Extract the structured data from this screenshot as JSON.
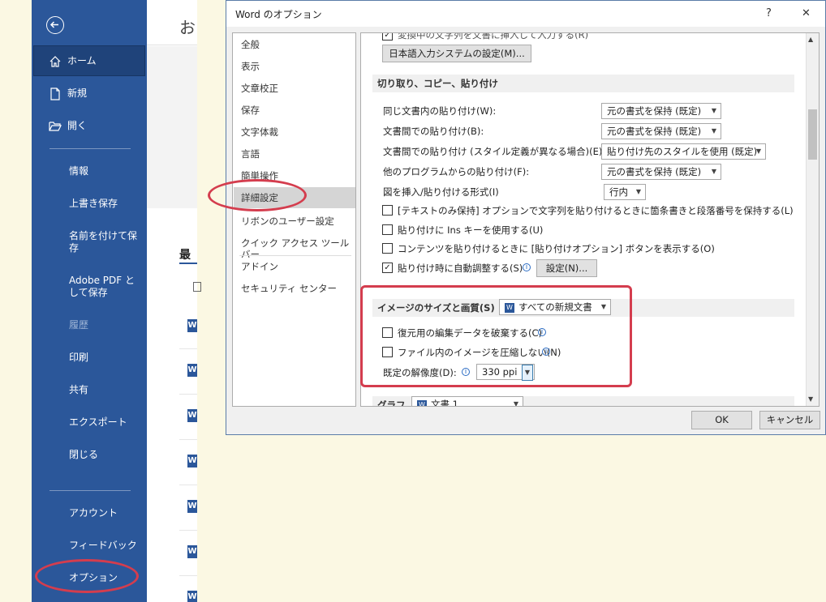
{
  "backstage": {
    "title_partial": "お",
    "recent_partial": "最",
    "items": {
      "home": "ホーム",
      "new": "新規",
      "open": "開く",
      "info": "情報",
      "save": "上書き保存",
      "saveas": "名前を付けて保存",
      "adobe": "Adobe PDF として保存",
      "history": "履歴",
      "print": "印刷",
      "share": "共有",
      "export": "エクスポート",
      "close": "閉じる",
      "account": "アカウント",
      "feedback": "フィードバック",
      "options": "オプション"
    },
    "doc_icon_letter": "W"
  },
  "dialog": {
    "title": "Word のオプション",
    "help": "?",
    "close": "✕",
    "nav": [
      "全般",
      "表示",
      "文章校正",
      "保存",
      "文字体裁",
      "言語",
      "簡単操作",
      "詳細設定",
      "リボンのユーザー設定",
      "クイック アクセス ツール バー",
      "アドイン",
      "セキュリティ センター"
    ],
    "nav_selected_index": 7,
    "ime_row_partial": "変換中の文字列を文書に挿入して入力する(R)",
    "ime_button": "日本語入力システムの設定(M)...",
    "cutpaste": {
      "header": "切り取り、コピー、貼り付け",
      "rows": [
        {
          "label": "同じ文書内の貼り付け(W):",
          "value": "元の書式を保持 (既定)"
        },
        {
          "label": "文書間での貼り付け(B):",
          "value": "元の書式を保持 (既定)"
        },
        {
          "label": "文書間での貼り付け (スタイル定義が異なる場合)(E):",
          "value": "貼り付け先のスタイルを使用 (既定)"
        },
        {
          "label": "他のプログラムからの貼り付け(F):",
          "value": "元の書式を保持 (既定)"
        },
        {
          "label": "図を挿入/貼り付ける形式(I)",
          "value": "行内"
        }
      ],
      "checks": [
        {
          "label": "[テキストのみ保持] オプションで文字列を貼り付けるときに箇条書きと段落番号を保持する(L)",
          "checked": false
        },
        {
          "label": "貼り付けに Ins キーを使用する(U)",
          "checked": false
        },
        {
          "label": "コンテンツを貼り付けるときに [貼り付けオプション] ボタンを表示する(O)",
          "checked": false
        },
        {
          "label": "貼り付け時に自動調整する(S)",
          "checked": true
        }
      ],
      "settings_button": "設定(N)..."
    },
    "image": {
      "header": "イメージのサイズと画質(S)",
      "doc_dropdown": "すべての新規文書",
      "checks": [
        {
          "label": "復元用の編集データを破棄する(C)",
          "checked": false
        },
        {
          "label": "ファイル内のイメージを圧縮しない(N)",
          "checked": false
        }
      ],
      "resolution_label": "既定の解像度(D):",
      "resolution_value": "330 ppi"
    },
    "chart": {
      "header": "グラフ",
      "doc_dropdown": "文書 1"
    },
    "ok": "OK",
    "cancel": "キャンセル"
  },
  "colors": {
    "sidebar": "#2b579a",
    "annotation": "#d43d4e"
  }
}
